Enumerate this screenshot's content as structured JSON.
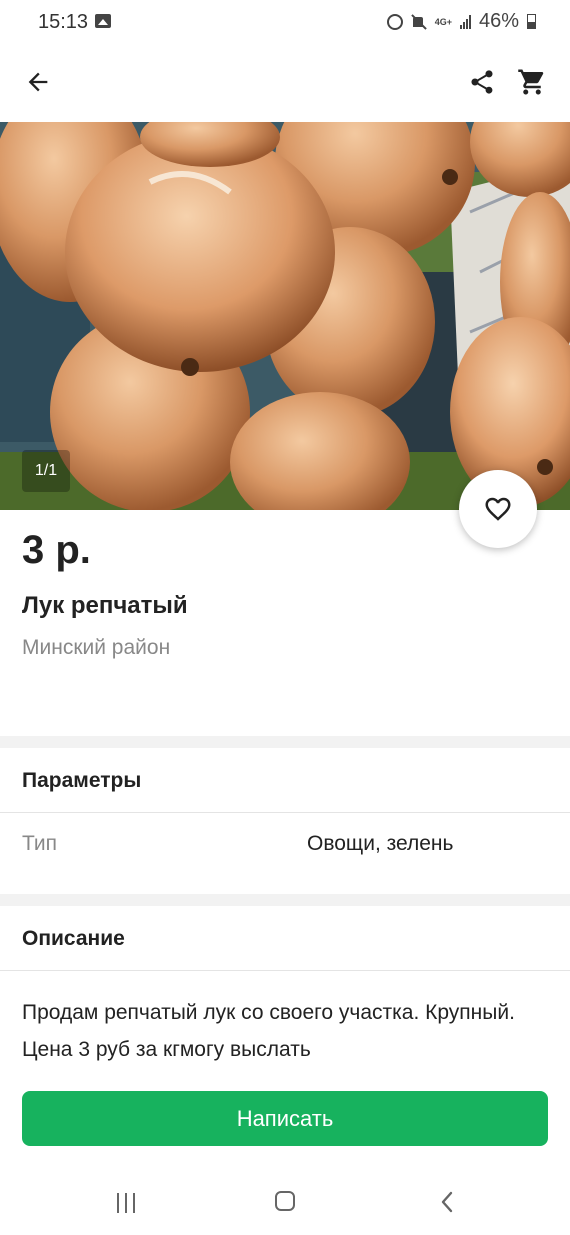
{
  "status_bar": {
    "time": "15:13",
    "network": "4G+",
    "battery": "46%"
  },
  "toolbar": {
    "back_icon": "arrow-left-icon",
    "share_icon": "share-icon",
    "cart_icon": "cart-icon"
  },
  "gallery": {
    "counter": "1/1",
    "image": "onions-photo"
  },
  "listing": {
    "price": "3 р.",
    "title": "Лук репчатый",
    "location": "Минский район"
  },
  "parameters": {
    "heading": "Параметры",
    "rows": [
      {
        "label": "Тип",
        "value": "Овощи, зелень"
      }
    ]
  },
  "description": {
    "heading": "Описание",
    "text": "Продам репчатый лук со своего участка. Крупный. Цена 3 руб за кгмогу выслать"
  },
  "actions": {
    "write_label": "Написать"
  },
  "colors": {
    "accent": "#17b25e",
    "text": "#222222",
    "muted": "#888888"
  }
}
